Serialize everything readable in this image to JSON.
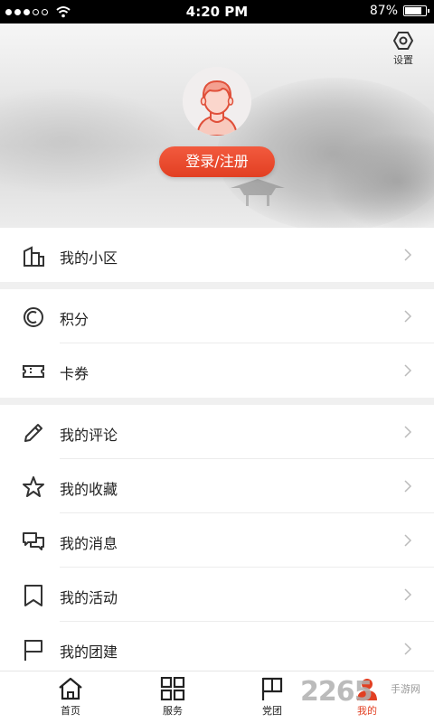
{
  "status_bar": {
    "time": "4:20 PM",
    "battery": "87%",
    "battery_level": 0.87
  },
  "header": {
    "settings_label": "设置",
    "login_button": "登录/注册",
    "accent_color": "#e23f22"
  },
  "sections": [
    {
      "items": [
        {
          "label": "我的小区",
          "icon": "building-icon"
        }
      ]
    },
    {
      "items": [
        {
          "label": "积分",
          "icon": "coin-icon"
        },
        {
          "label": "卡券",
          "icon": "ticket-icon"
        }
      ]
    },
    {
      "items": [
        {
          "label": "我的评论",
          "icon": "pencil-icon"
        },
        {
          "label": "我的收藏",
          "icon": "star-icon"
        },
        {
          "label": "我的消息",
          "icon": "message-icon"
        },
        {
          "label": "我的活动",
          "icon": "bookmark-icon"
        },
        {
          "label": "我的团建",
          "icon": "flag-icon"
        }
      ]
    }
  ],
  "tabbar": {
    "tabs": [
      {
        "label": "首页",
        "icon": "home-icon"
      },
      {
        "label": "服务",
        "icon": "grid-icon"
      },
      {
        "label": "党团",
        "icon": "flag-icon"
      },
      {
        "label": "我的",
        "icon": "user-icon",
        "active": true
      }
    ]
  },
  "watermark": {
    "text": "2265",
    "sub": "手游网"
  }
}
